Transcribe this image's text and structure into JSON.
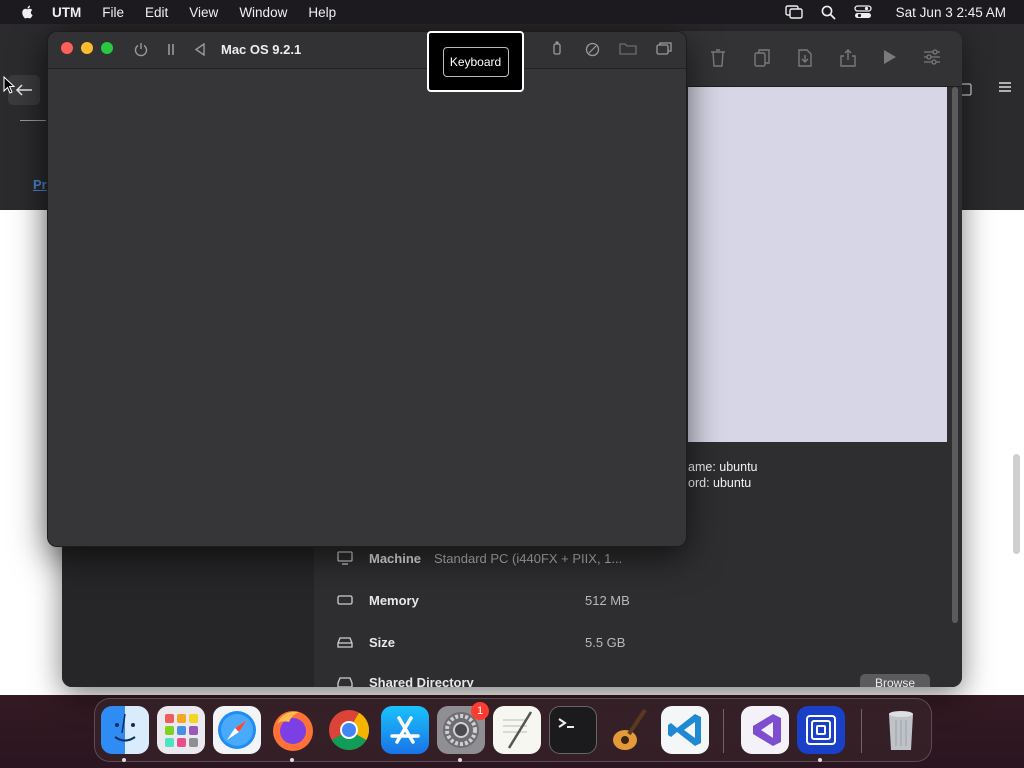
{
  "menubar": {
    "app_name": "UTM",
    "items": [
      "File",
      "Edit",
      "View",
      "Window",
      "Help"
    ],
    "clock": "Sat Jun 3  2:45 AM"
  },
  "background_page": {
    "link_fragment": "Pr"
  },
  "utm_window": {
    "credentials": {
      "line1": "ame: ubuntu",
      "line2": "ord: ubuntu"
    },
    "details": [
      {
        "label": "Machine",
        "value": "Standard PC (i440FX + PIIX, 1...",
        "icon": "monitor-icon"
      },
      {
        "label": "Memory",
        "value": "512 MB",
        "icon": "memory-icon"
      },
      {
        "label": "Size",
        "value": "5.5 GB",
        "icon": "drive-icon"
      },
      {
        "label": "Shared Directory",
        "value": "",
        "icon": "folder-icon"
      }
    ],
    "browse_label": "Browse"
  },
  "vm_window": {
    "title": "Mac OS 9.2.1"
  },
  "tooltip": {
    "label": "Keyboard"
  },
  "dock": {
    "apps": [
      "Finder",
      "Launchpad",
      "Safari",
      "Firefox",
      "Chrome",
      "App Store",
      "System Settings",
      "TextEdit",
      "Terminal",
      "GarageBand",
      "Visual Studio Code",
      "Visual Studio",
      "UTM",
      "Trash"
    ],
    "settings_badge": "1"
  },
  "colors": {
    "close": "#fe5f57",
    "minimize": "#febc2e",
    "zoom": "#28c840",
    "link": "#4a8ad8"
  }
}
